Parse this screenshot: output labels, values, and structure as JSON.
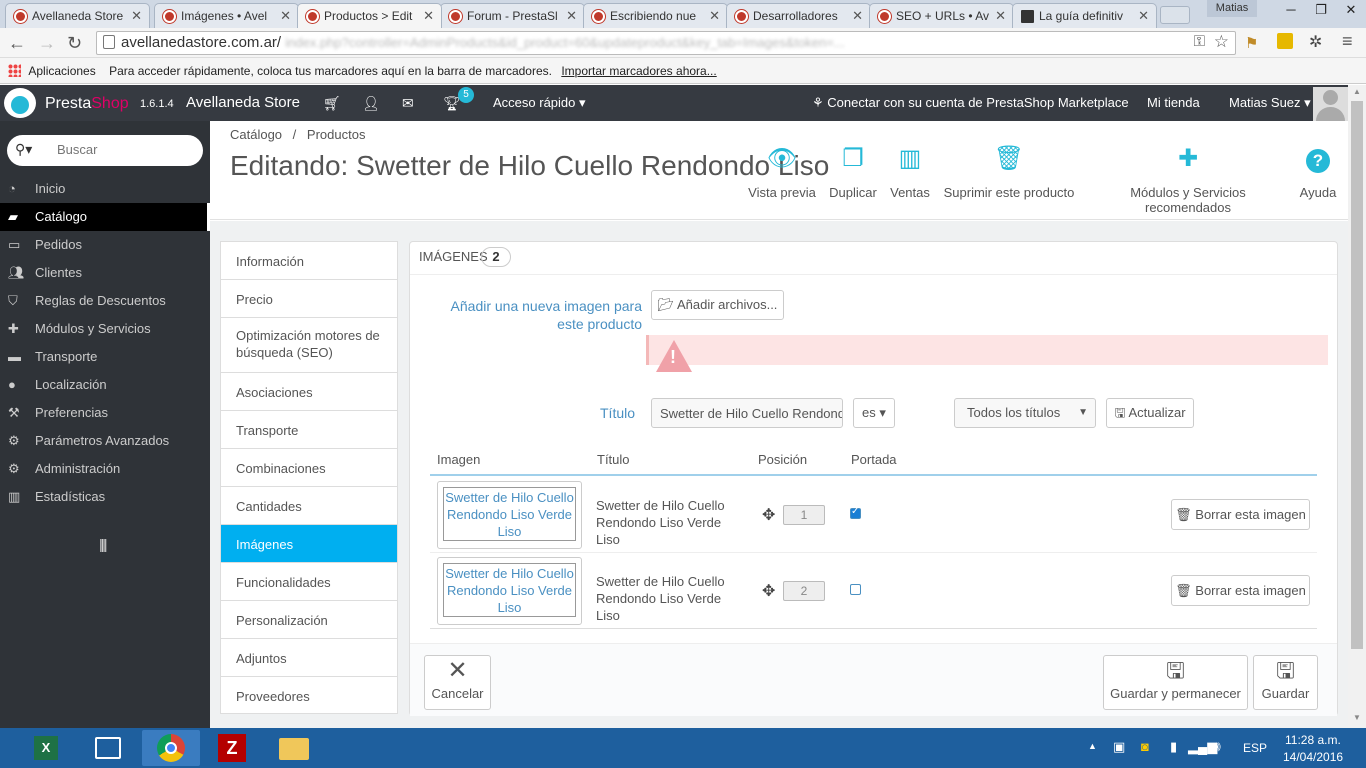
{
  "browser": {
    "tabs": [
      {
        "label": "Avellaneda Store"
      },
      {
        "label": "Imágenes • Avel"
      },
      {
        "label": "Productos > Edit"
      },
      {
        "label": "Forum - PrestaSl"
      },
      {
        "label": "Escribiendo nue"
      },
      {
        "label": "Desarrolladores"
      },
      {
        "label": "SEO + URLs • Av"
      },
      {
        "label": "La guía definitiv"
      }
    ],
    "user_badge": "Matias",
    "url": "avellanedastore.com.ar/",
    "url_blur": "index.php?controller=AdminProducts&id_product=60&updateproduct&key_tab=Images&token=...",
    "bookmarks": {
      "apps": "Aplicaciones",
      "hint": "Para acceder rápidamente, coloca tus marcadores aquí en la barra de marcadores.",
      "import": "Importar marcadores ahora..."
    }
  },
  "header": {
    "brand_a": "Presta",
    "brand_b": "Shop",
    "version": "1.6.1.4",
    "store": "Avellaneda Store",
    "notif_count": "5",
    "quick_access": "Acceso rápido",
    "marketplace": "Conectar con su cuenta de PrestaShop Marketplace",
    "my_store": "Mi tienda",
    "user": "Matias Suez"
  },
  "sidebar": {
    "search_placeholder": "Buscar",
    "items": [
      {
        "label": "Inicio"
      },
      {
        "label": "Catálogo"
      },
      {
        "label": "Pedidos"
      },
      {
        "label": "Clientes"
      },
      {
        "label": "Reglas de Descuentos"
      },
      {
        "label": "Módulos y Servicios"
      },
      {
        "label": "Transporte"
      },
      {
        "label": "Localización"
      },
      {
        "label": "Preferencias"
      },
      {
        "label": "Parámetros Avanzados"
      },
      {
        "label": "Administración"
      },
      {
        "label": "Estadísticas"
      }
    ]
  },
  "page": {
    "breadcrumb_1": "Catálogo",
    "breadcrumb_sep": "/",
    "breadcrumb_2": "Productos",
    "title": "Editando: Swetter de Hilo Cuello Rendondo Liso",
    "toolbar": [
      {
        "label": "Vista previa"
      },
      {
        "label": "Duplicar"
      },
      {
        "label": "Ventas"
      },
      {
        "label": "Suprimir este producto"
      },
      {
        "label": "Módulos y Servicios recomendados"
      },
      {
        "label": "Ayuda"
      }
    ]
  },
  "product_tabs": [
    {
      "label": "Información"
    },
    {
      "label": "Precio"
    },
    {
      "label": "Optimización motores de búsqueda (SEO)"
    },
    {
      "label": "Asociaciones"
    },
    {
      "label": "Transporte"
    },
    {
      "label": "Combinaciones"
    },
    {
      "label": "Cantidades"
    },
    {
      "label": "Imágenes"
    },
    {
      "label": "Funcionalidades"
    },
    {
      "label": "Personalización"
    },
    {
      "label": "Adjuntos"
    },
    {
      "label": "Proveedores"
    }
  ],
  "panel": {
    "heading": "IMÁGENES",
    "count": "2",
    "add_label": "Añadir una nueva imagen para este producto",
    "add_button": "Añadir archivos...",
    "title_label": "Título",
    "title_value": "Swetter de Hilo Cuello Rendondo Liso",
    "lang": "es",
    "all_titles": "Todos los títulos",
    "update_button": "Actualizar",
    "columns": {
      "image": "Imagen",
      "title": "Título",
      "position": "Posición",
      "cover": "Portada"
    },
    "rows": [
      {
        "image_alt": "Swetter de Hilo Cuello Rendondo Liso Verde Liso",
        "title": "Swetter de Hilo Cuello Rendondo Liso Verde Liso",
        "position": "1",
        "cover": true,
        "delete": "Borrar esta imagen"
      },
      {
        "image_alt": "Swetter de Hilo Cuello Rendondo Liso Verde Liso",
        "title": "Swetter de Hilo Cuello Rendondo Liso Verde Liso",
        "position": "2",
        "cover": false,
        "delete": "Borrar esta imagen"
      }
    ],
    "cancel": "Cancelar",
    "save_stay": "Guardar y permanecer",
    "save": "Guardar"
  },
  "taskbar": {
    "lang": "ESP",
    "time": "11:28 a.m.",
    "date": "14/04/2016"
  },
  "colors": {
    "accent": "#25b9d7",
    "active_tab": "#00aff0",
    "sidebar": "#2f3338",
    "header": "#363a41",
    "error": "#fde4e4"
  }
}
